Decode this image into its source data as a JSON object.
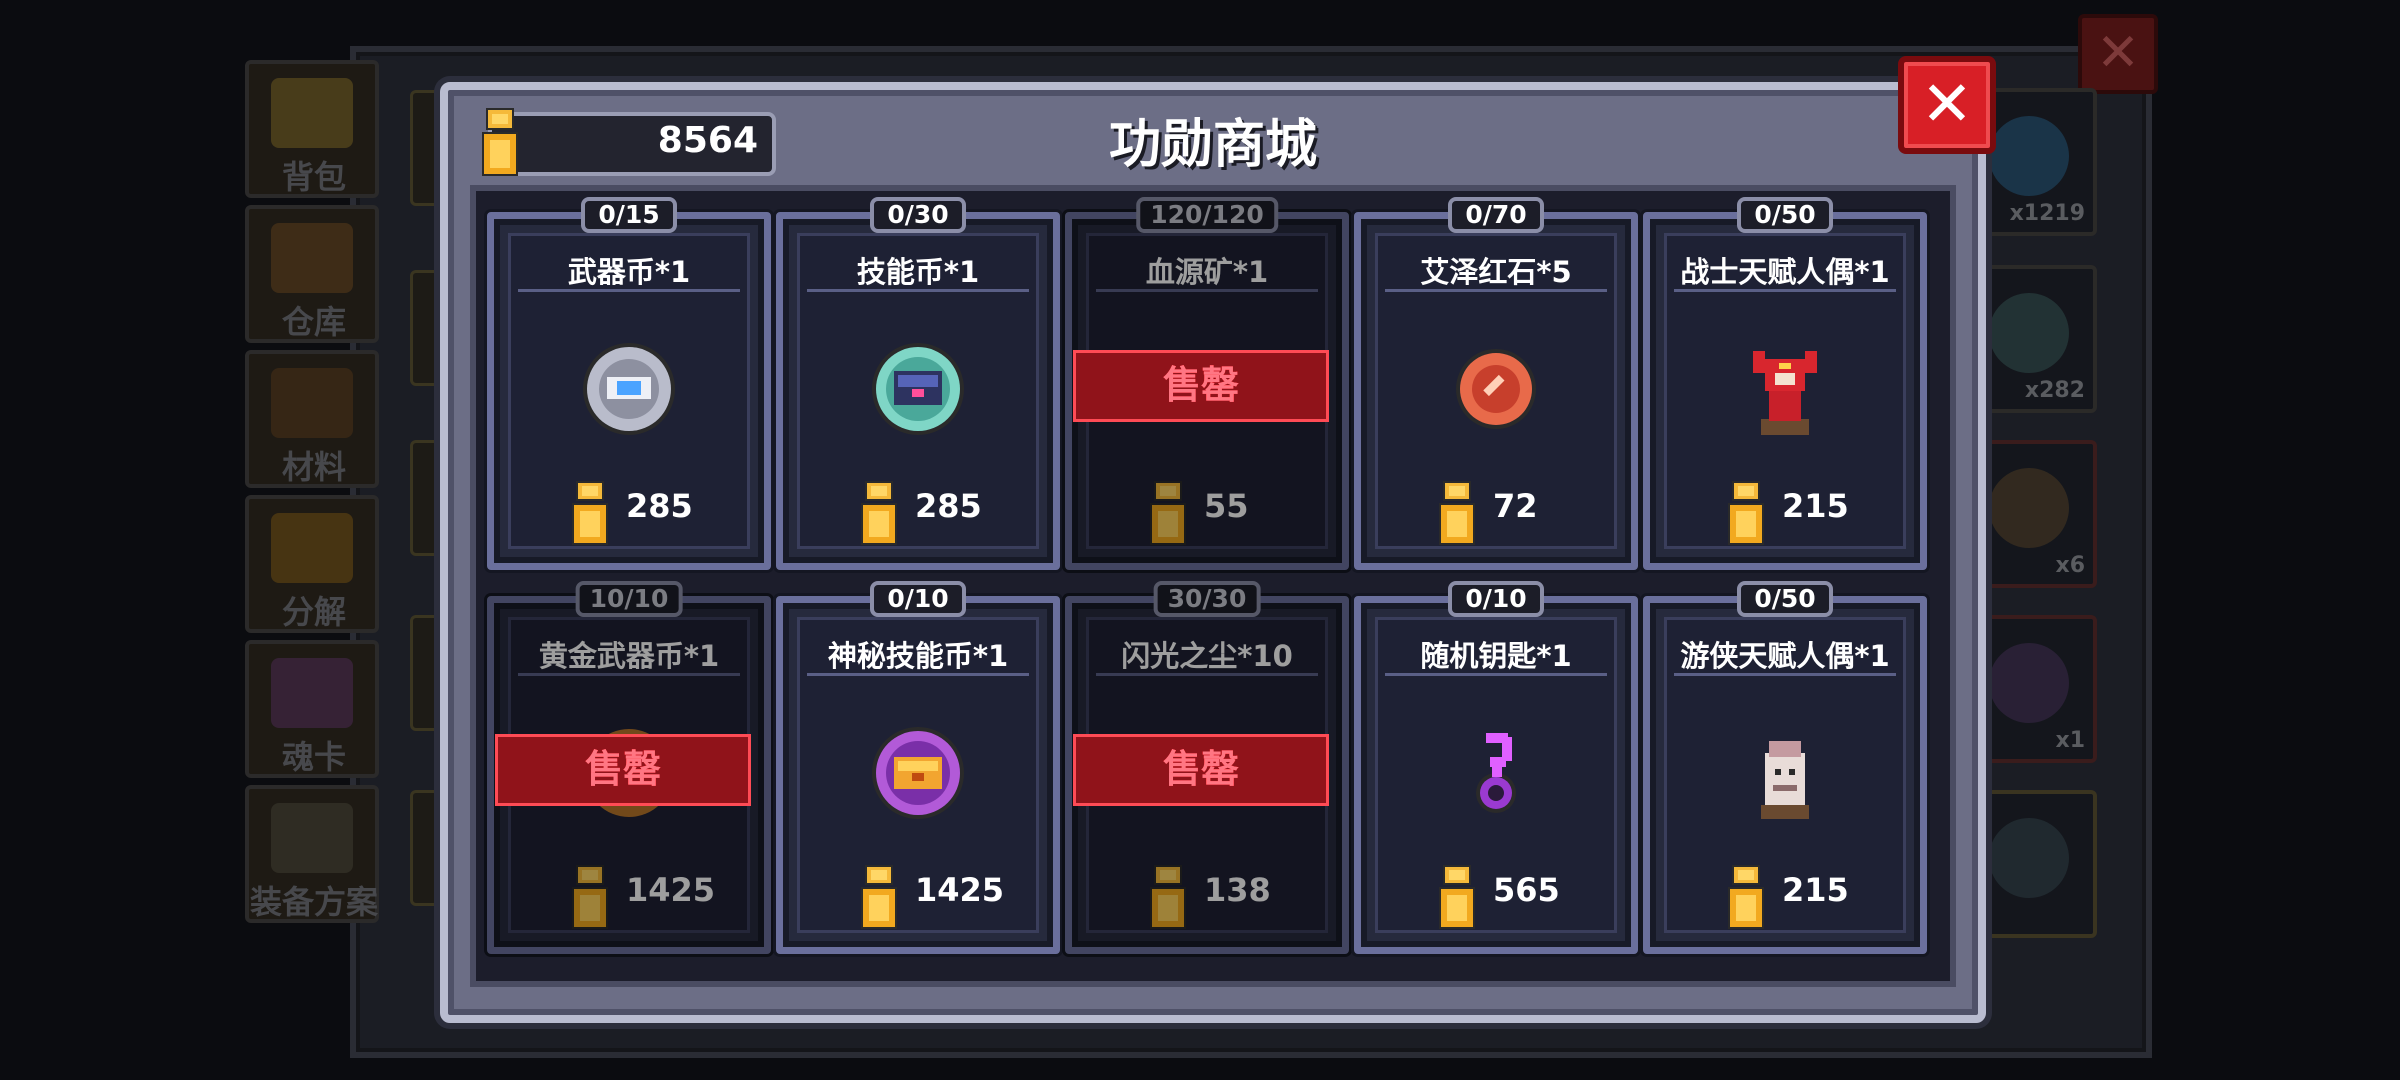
{
  "shop": {
    "title": "功勋商城",
    "currency_value": "8564",
    "close_label": "✕",
    "sold_out_label": "售罄",
    "items": [
      {
        "limit": "0/15",
        "name": "武器币*1",
        "price": "285",
        "icon": "weapon-coin-icon",
        "sold_out": false
      },
      {
        "limit": "0/30",
        "name": "技能币*1",
        "price": "285",
        "icon": "skill-coin-icon",
        "sold_out": false
      },
      {
        "limit": "120/120",
        "name": "血源矿*1",
        "price": "55",
        "icon": "blood-ore-icon",
        "sold_out": true
      },
      {
        "limit": "0/70",
        "name": "艾泽红石*5",
        "price": "72",
        "icon": "red-stone-icon",
        "sold_out": false
      },
      {
        "limit": "0/50",
        "name": "战士天赋人偶*1",
        "price": "215",
        "icon": "warrior-doll-icon",
        "sold_out": false
      },
      {
        "limit": "10/10",
        "name": "黄金武器币*1",
        "price": "1425",
        "icon": "gold-weapon-coin-icon",
        "sold_out": true
      },
      {
        "limit": "0/10",
        "name": "神秘技能币*1",
        "price": "1425",
        "icon": "mystic-skill-coin-icon",
        "sold_out": false
      },
      {
        "limit": "30/30",
        "name": "闪光之尘*10",
        "price": "138",
        "icon": "flash-dust-icon",
        "sold_out": true
      },
      {
        "limit": "0/10",
        "name": "随机钥匙*1",
        "price": "565",
        "icon": "random-key-icon",
        "sold_out": false
      },
      {
        "limit": "0/50",
        "name": "游侠天赋人偶*1",
        "price": "215",
        "icon": "ranger-doll-icon",
        "sold_out": false
      }
    ]
  },
  "background": {
    "sidebar": [
      {
        "label": "背包",
        "icon": "backpack-icon"
      },
      {
        "label": "仓库",
        "icon": "warehouse-icon"
      },
      {
        "label": "材料",
        "icon": "materials-icon"
      },
      {
        "label": "分解",
        "icon": "disassemble-icon"
      },
      {
        "label": "魂卡",
        "icon": "soul-card-icon"
      },
      {
        "label": "装备方案",
        "icon": "equipment-plan-icon"
      }
    ],
    "right_counts": [
      "x1219",
      "x282",
      "x6",
      "x1"
    ],
    "close_label": "✕"
  },
  "colors": {
    "accent_red": "#d81f26",
    "medal_gold": "#f2b32a",
    "panel_border": "#b9bcd0",
    "card_border": "#6a6f9c"
  }
}
